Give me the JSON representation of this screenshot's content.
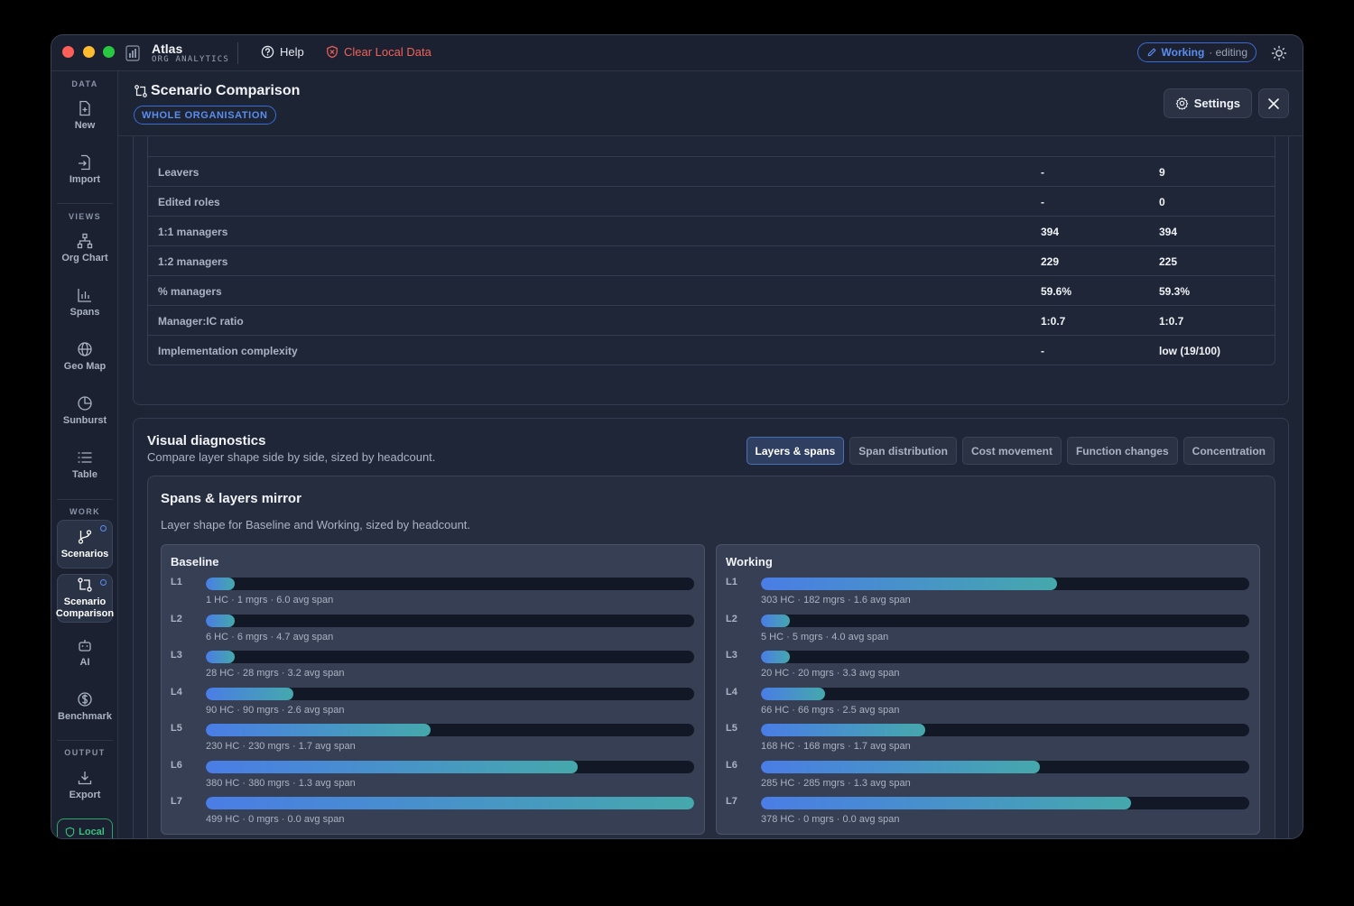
{
  "titlebar": {
    "app_name": "Atlas",
    "app_subtitle": "ORG ANALYTICS",
    "help_label": "Help",
    "clear_label": "Clear Local Data",
    "status_strong": "Working",
    "status_muted": "· editing"
  },
  "sidebar": {
    "sections": {
      "data": "DATA",
      "views": "VIEWS",
      "work": "WORK",
      "output": "OUTPUT"
    },
    "items": {
      "new": "New",
      "import": "Import",
      "org_chart": "Org Chart",
      "spans": "Spans",
      "geo_map": "Geo Map",
      "sunburst": "Sunburst",
      "table": "Table",
      "scenarios": "Scenarios",
      "scenario_comparison": "Scenario Comparison",
      "ai": "AI",
      "benchmark": "Benchmark",
      "export": "Export"
    },
    "local_label": "Local"
  },
  "header": {
    "title": "Scenario Comparison",
    "scope": "WHOLE ORGANISATION",
    "settings_label": "Settings"
  },
  "metrics": {
    "rows": [
      {
        "label": "Leavers",
        "baseline": "-",
        "working": "9"
      },
      {
        "label": "Edited roles",
        "baseline": "-",
        "working": "0"
      },
      {
        "label": "1:1 managers",
        "baseline": "394",
        "working": "394"
      },
      {
        "label": "1:2 managers",
        "baseline": "229",
        "working": "225"
      },
      {
        "label": "% managers",
        "baseline": "59.6%",
        "working": "59.3%"
      },
      {
        "label": "Manager:IC ratio",
        "baseline": "1:0.7",
        "working": "1:0.7"
      },
      {
        "label": "Implementation complexity",
        "baseline": "-",
        "working": "low (19/100)"
      }
    ]
  },
  "diagnostics": {
    "title": "Visual diagnostics",
    "subtitle": "Compare layer shape side by side, sized by headcount.",
    "tabs": [
      "Layers & spans",
      "Span distribution",
      "Cost movement",
      "Function changes",
      "Concentration"
    ],
    "active_tab": 0
  },
  "mirror": {
    "title": "Spans & layers mirror",
    "subtitle": "Layer shape for Baseline and Working, sized by headcount.",
    "baseline": {
      "title": "Baseline",
      "layers": [
        {
          "tag": "L1",
          "fill": 0.06,
          "stats": "1 HC · 1 mgrs · 6.0 avg span"
        },
        {
          "tag": "L2",
          "fill": 0.06,
          "stats": "6 HC · 6 mgrs · 4.7 avg span"
        },
        {
          "tag": "L3",
          "fill": 0.06,
          "stats": "28 HC · 28 mgrs · 3.2 avg span"
        },
        {
          "tag": "L4",
          "fill": 0.18,
          "stats": "90 HC · 90 mgrs · 2.6 avg span"
        },
        {
          "tag": "L5",
          "fill": 0.46,
          "stats": "230 HC · 230 mgrs · 1.7 avg span"
        },
        {
          "tag": "L6",
          "fill": 0.761,
          "stats": "380 HC · 380 mgrs · 1.3 avg span"
        },
        {
          "tag": "L7",
          "fill": 1.0,
          "stats": "499 HC · 0 mgrs · 0.0 avg span"
        }
      ]
    },
    "working": {
      "title": "Working",
      "layers": [
        {
          "tag": "L1",
          "fill": 0.607,
          "stats": "303 HC · 182 mgrs · 1.6 avg span"
        },
        {
          "tag": "L2",
          "fill": 0.06,
          "stats": "5 HC · 5 mgrs · 4.0 avg span"
        },
        {
          "tag": "L3",
          "fill": 0.06,
          "stats": "20 HC · 20 mgrs · 3.3 avg span"
        },
        {
          "tag": "L4",
          "fill": 0.132,
          "stats": "66 HC · 66 mgrs · 2.5 avg span"
        },
        {
          "tag": "L5",
          "fill": 0.337,
          "stats": "168 HC · 168 mgrs · 1.7 avg span"
        },
        {
          "tag": "L6",
          "fill": 0.571,
          "stats": "285 HC · 285 mgrs · 1.3 avg span"
        },
        {
          "tag": "L7",
          "fill": 0.757,
          "stats": "378 HC · 0 mgrs · 0.0 avg span"
        }
      ]
    }
  }
}
